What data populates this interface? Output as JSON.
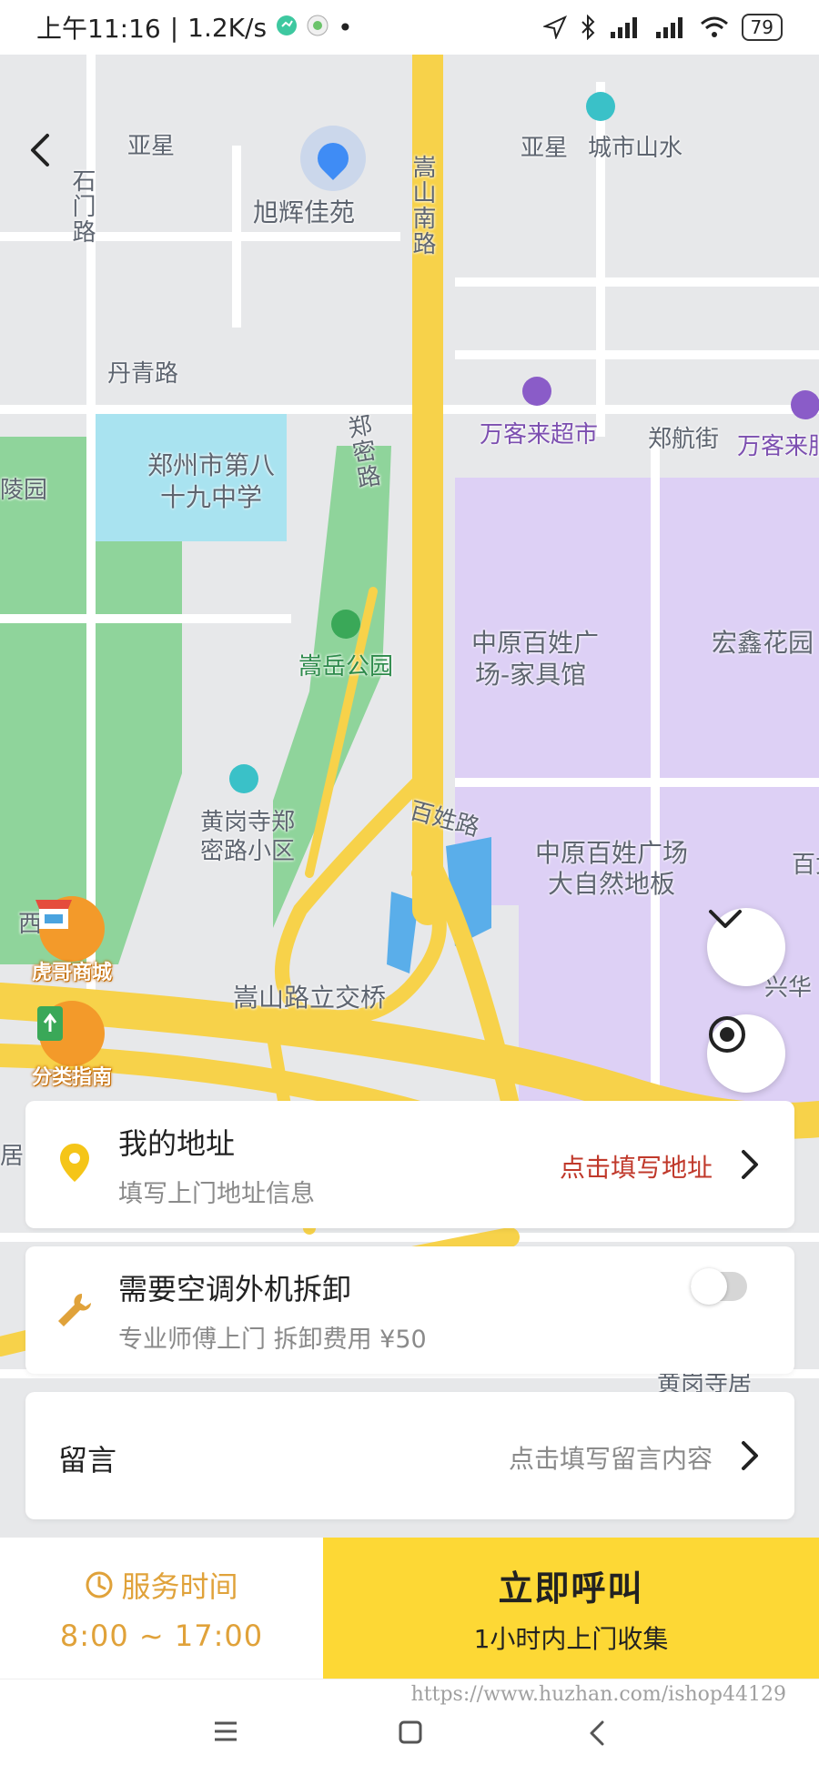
{
  "status_bar": {
    "time": "上午11:16",
    "speed": "1.2K/s",
    "battery": "79"
  },
  "map": {
    "labels": {
      "yaxing_left": "亚星",
      "yaxing_right": "亚星",
      "chengshi_shanshui": "城市山水",
      "shimen_road": "石门路",
      "xuhui_jiayuan": "旭辉佳苑",
      "songshan_south_road": "嵩山南路",
      "danqing_road": "丹青路",
      "zhengmi_road": "郑密路",
      "wankelai_supermarket": "万客来超市",
      "zhenghang_street": "郑航街",
      "wankelai_right": "万客来服",
      "school_line1": "郑州市第八",
      "school_line2": "十九中学",
      "ling_garden": "陵园",
      "zhongyuan_furniture_1": "中原百姓广",
      "zhongyuan_furniture_2": "场-家具馆",
      "hongxin_garden": "宏鑫花园",
      "songyue_park": "嵩岳公园",
      "huanggangsi_1": "黄岗寺郑",
      "huanggangsi_2": "密路小区",
      "baixing_road": "百姓路",
      "zhongyuan_floor_1": "中原百姓广场",
      "zhongyuan_floor_2": "大自然地板",
      "bai_right": "百女",
      "xinghua": "兴华",
      "xi": "西",
      "songshan_interchange": "嵩山路立交桥",
      "ju_left": "居",
      "huanggang_bottom": "黄岗寺居"
    },
    "badges": {
      "shop": "虎哥商城",
      "guide": "分类指南"
    }
  },
  "address_card": {
    "title": "我的地址",
    "subtitle": "填写上门地址信息",
    "action": "点击填写地址"
  },
  "ac_card": {
    "title": "需要空调外机拆卸",
    "subtitle": "专业师傅上门 拆卸费用 ¥50",
    "toggle_on": false
  },
  "message_card": {
    "title": "留言",
    "placeholder": "点击填写留言内容"
  },
  "bottom": {
    "service_time_label": "服务时间",
    "service_hours": "8:00 ~ 17:00",
    "call_main": "立即呼叫",
    "call_sub": "1小时内上门收集"
  },
  "watermark": "https://www.huzhan.com/ishop44129",
  "colors": {
    "accent_yellow": "#fdd835",
    "service_orange": "#e0a23a",
    "action_red": "#c0392b",
    "road_yellow": "#f7d24a",
    "park_green": "#8fd49b",
    "mall_purple": "#ddd0f5",
    "school_blue": "#a9e3f0"
  }
}
